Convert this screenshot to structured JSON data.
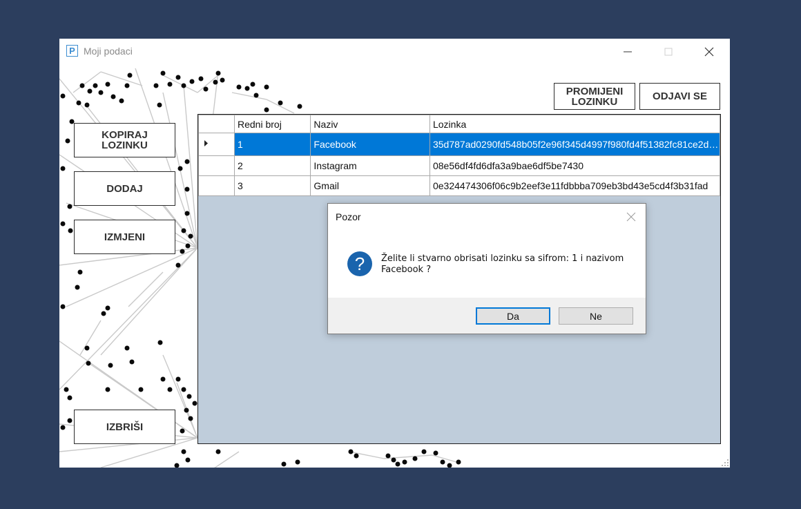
{
  "window": {
    "icon_letter": "P",
    "title": "Moji podaci"
  },
  "top_buttons": {
    "change_password": "PROMIJENI\nLOZINKU",
    "logout": "ODJAVI SE"
  },
  "side_buttons": {
    "copy_password": "KOPIRAJ\nLOZINKU",
    "add": "DODAJ",
    "edit": "IZMJENI",
    "delete": "IZBRIŠI"
  },
  "table": {
    "columns": [
      "Redni broj",
      "Naziv",
      "Lozinka"
    ],
    "rows": [
      {
        "id": "1",
        "name": "Facebook",
        "password": "35d787ad0290fd548b05f2e96f345d4997f980fd4f51382fc81ce2d2...",
        "selected": true
      },
      {
        "id": "2",
        "name": "Instagram",
        "password": "08e56df4fd6dfa3a9bae6df5be7430",
        "selected": false
      },
      {
        "id": "3",
        "name": "Gmail",
        "password": "0e324474306f06c9b2eef3e11fdbbba709eb3bd43e5cd4f3b31fad",
        "selected": false
      }
    ]
  },
  "dialog": {
    "title": "Pozor",
    "icon": "question-icon",
    "message": "Želite li stvarno obrisati lozinku sa sifrom: 1 i nazivom\nFacebook ?",
    "yes_label": "Da",
    "no_label": "Ne"
  },
  "colors": {
    "desktop": "#2c3e5e",
    "selection": "#0078d7",
    "grid_background": "#bfcddb",
    "dialog_icon": "#1a64ad"
  }
}
